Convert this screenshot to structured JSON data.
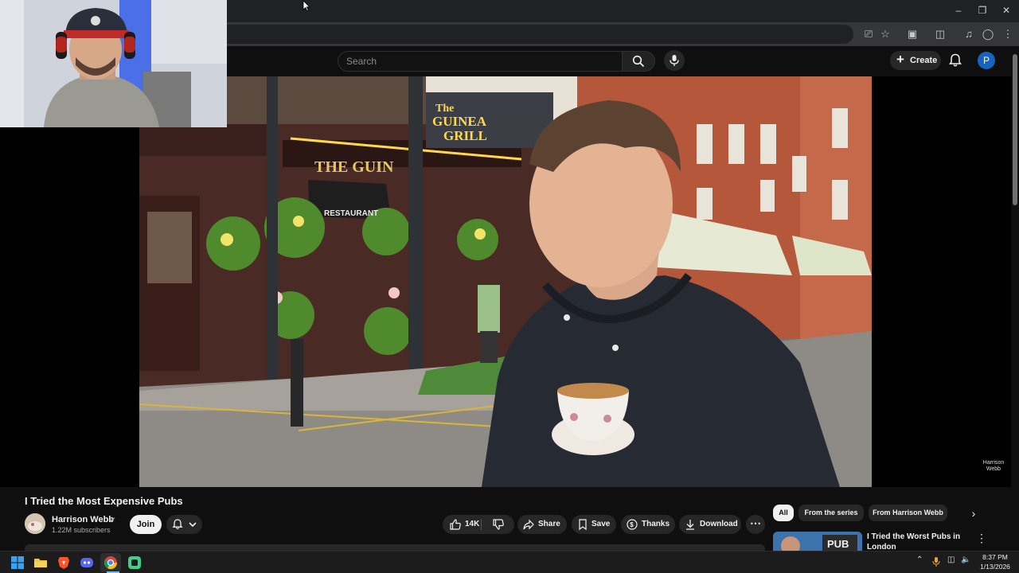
{
  "youtube": {
    "search_placeholder": "Search",
    "create_label": "Create",
    "account_initial": "P"
  },
  "video": {
    "title": "I Tried the Most Expensive Pubs",
    "watermark_line1": "Harrison",
    "watermark_line2": "Webb",
    "sign_text_line1": "The",
    "sign_text_line2": "GUINEA",
    "sign_text_line3": "GRILL",
    "pub_name": "THE GUIN",
    "awning_text": "RESTAURANT"
  },
  "channel": {
    "name": "Harrison Webb",
    "subscribers": "1.22M subscribers",
    "join_label": "Join"
  },
  "actions": {
    "likes": "14K",
    "share": "Share",
    "save": "Save",
    "thanks": "Thanks",
    "download": "Download"
  },
  "chips": [
    "All",
    "From the series",
    "From Harrison Webb"
  ],
  "recommended": {
    "title": "I Tried the Worst Pubs in London",
    "thumb_text": "PUB"
  },
  "taskbar": {
    "time": "8:37 PM",
    "date": "1/13/2026"
  },
  "colors": {
    "accent_blue": "#1565c0",
    "brick": "#b5573a",
    "pub_wall": "#4a2a24",
    "hoodie": "#252a33"
  }
}
